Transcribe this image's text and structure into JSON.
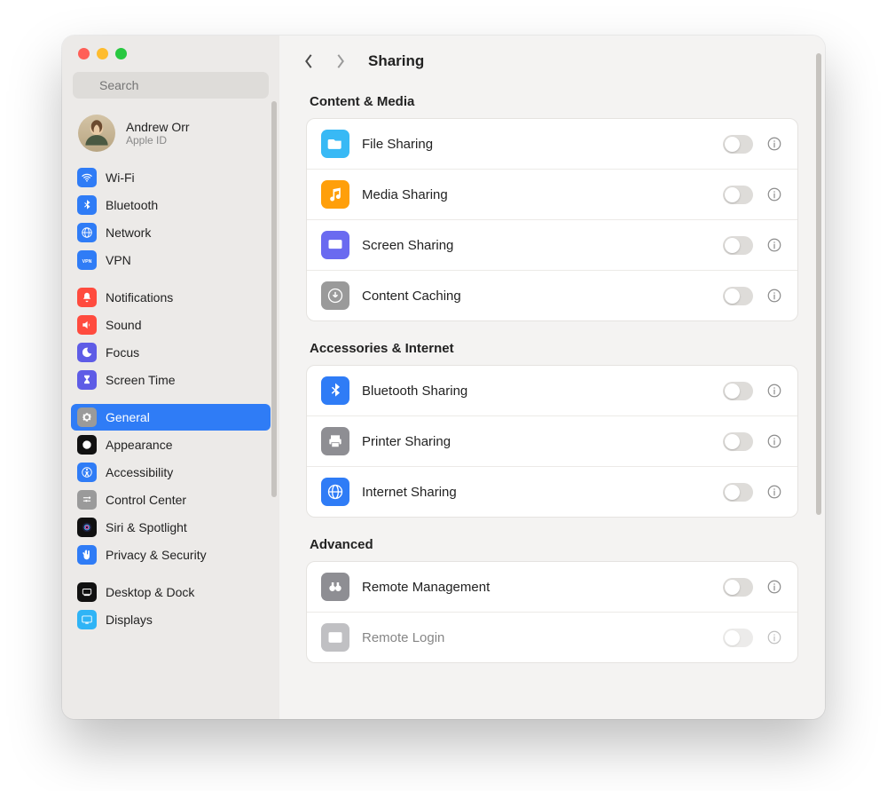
{
  "window": {
    "title": "Sharing"
  },
  "search": {
    "placeholder": "Search"
  },
  "profile": {
    "name": "Andrew Orr",
    "sub": "Apple ID"
  },
  "sidebar": {
    "groups": [
      [
        {
          "label": "Wi-Fi",
          "icon": "wifi",
          "bg": "#2f7cf6"
        },
        {
          "label": "Bluetooth",
          "icon": "bluetooth",
          "bg": "#2f7cf6"
        },
        {
          "label": "Network",
          "icon": "globe",
          "bg": "#2f7cf6"
        },
        {
          "label": "VPN",
          "icon": "vpn",
          "bg": "#2f7cf6"
        }
      ],
      [
        {
          "label": "Notifications",
          "icon": "bell",
          "bg": "#ff4b3e"
        },
        {
          "label": "Sound",
          "icon": "speaker",
          "bg": "#ff4b3e"
        },
        {
          "label": "Focus",
          "icon": "moon",
          "bg": "#5e5ce6"
        },
        {
          "label": "Screen Time",
          "icon": "hourglass",
          "bg": "#5e5ce6"
        }
      ],
      [
        {
          "label": "General",
          "icon": "gear",
          "bg": "#9a9a9a",
          "active": true
        },
        {
          "label": "Appearance",
          "icon": "appearance",
          "bg": "#111"
        },
        {
          "label": "Accessibility",
          "icon": "accessibility",
          "bg": "#2f7cf6"
        },
        {
          "label": "Control Center",
          "icon": "sliders",
          "bg": "#9a9a9a"
        },
        {
          "label": "Siri & Spotlight",
          "icon": "siri",
          "bg": "#111"
        },
        {
          "label": "Privacy & Security",
          "icon": "hand",
          "bg": "#2f7cf6"
        }
      ],
      [
        {
          "label": "Desktop & Dock",
          "icon": "dock",
          "bg": "#111"
        },
        {
          "label": "Displays",
          "icon": "display",
          "bg": "#2fb4f6"
        }
      ]
    ]
  },
  "content": {
    "sections": [
      {
        "title": "Content & Media",
        "rows": [
          {
            "label": "File Sharing",
            "icon": "folder",
            "bg": "#38b9f5",
            "on": false
          },
          {
            "label": "Media Sharing",
            "icon": "music",
            "bg": "#ff9f0a",
            "on": false
          },
          {
            "label": "Screen Sharing",
            "icon": "screen",
            "bg": "#6a6af0",
            "on": false
          },
          {
            "label": "Content Caching",
            "icon": "download",
            "bg": "#9a9a9a",
            "on": false
          }
        ]
      },
      {
        "title": "Accessories & Internet",
        "rows": [
          {
            "label": "Bluetooth Sharing",
            "icon": "bluetooth",
            "bg": "#2f7cf6",
            "on": false
          },
          {
            "label": "Printer Sharing",
            "icon": "printer",
            "bg": "#8e8e93",
            "on": false
          },
          {
            "label": "Internet Sharing",
            "icon": "globe",
            "bg": "#2f7cf6",
            "on": false
          }
        ]
      },
      {
        "title": "Advanced",
        "rows": [
          {
            "label": "Remote Management",
            "icon": "binoc",
            "bg": "#8e8e93",
            "on": false
          },
          {
            "label": "Remote Login",
            "icon": "terminal",
            "bg": "#8e8e93",
            "on": false
          }
        ]
      }
    ]
  }
}
